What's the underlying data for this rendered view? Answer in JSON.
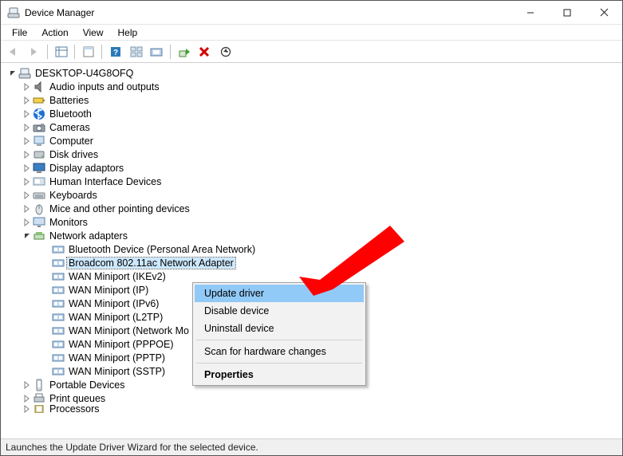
{
  "window": {
    "title": "Device Manager"
  },
  "menu": {
    "file": "File",
    "action": "Action",
    "view": "View",
    "help": "Help"
  },
  "tree": {
    "root": "DESKTOP-U4G8OFQ",
    "categories": [
      {
        "label": "Audio inputs and outputs",
        "expanded": false,
        "icon": "audio"
      },
      {
        "label": "Batteries",
        "expanded": false,
        "icon": "battery"
      },
      {
        "label": "Bluetooth",
        "expanded": false,
        "icon": "bluetooth"
      },
      {
        "label": "Cameras",
        "expanded": false,
        "icon": "camera"
      },
      {
        "label": "Computer",
        "expanded": false,
        "icon": "computer"
      },
      {
        "label": "Disk drives",
        "expanded": false,
        "icon": "disk"
      },
      {
        "label": "Display adaptors",
        "expanded": false,
        "icon": "display"
      },
      {
        "label": "Human Interface Devices",
        "expanded": false,
        "icon": "hid"
      },
      {
        "label": "Keyboards",
        "expanded": false,
        "icon": "keyboard"
      },
      {
        "label": "Mice and other pointing devices",
        "expanded": false,
        "icon": "mouse"
      },
      {
        "label": "Monitors",
        "expanded": false,
        "icon": "monitor"
      },
      {
        "label": "Network adapters",
        "expanded": true,
        "icon": "network",
        "children": [
          {
            "label": "Bluetooth Device (Personal Area Network)"
          },
          {
            "label": "Broadcom 802.11ac Network Adapter",
            "selected": true
          },
          {
            "label": "WAN Miniport (IKEv2)"
          },
          {
            "label": "WAN Miniport (IP)"
          },
          {
            "label": "WAN Miniport (IPv6)"
          },
          {
            "label": "WAN Miniport (L2TP)"
          },
          {
            "label": "WAN Miniport (Network Monitor)",
            "truncated": "WAN Miniport (Network Mo"
          },
          {
            "label": "WAN Miniport (PPPOE)"
          },
          {
            "label": "WAN Miniport (PPTP)"
          },
          {
            "label": "WAN Miniport (SSTP)"
          }
        ]
      },
      {
        "label": "Portable Devices",
        "expanded": false,
        "icon": "portable"
      },
      {
        "label": "Print queues",
        "expanded": false,
        "icon": "printer"
      },
      {
        "label": "Processors",
        "expanded": false,
        "icon": "cpu",
        "cutoff": true
      }
    ]
  },
  "contextMenu": {
    "updateDriver": "Update driver",
    "disableDevice": "Disable device",
    "uninstallDevice": "Uninstall device",
    "scanHardware": "Scan for hardware changes",
    "properties": "Properties"
  },
  "statusbar": {
    "text": "Launches the Update Driver Wizard for the selected device."
  },
  "annotation": {
    "color": "#ff0000"
  }
}
